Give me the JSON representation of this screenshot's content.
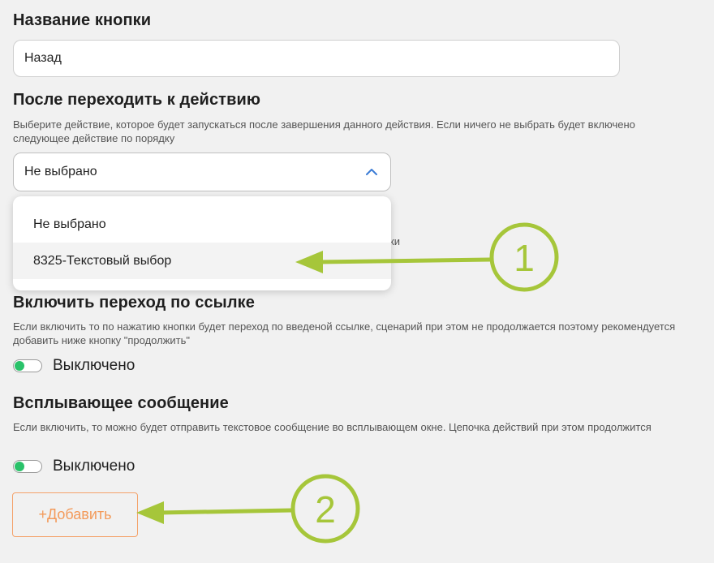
{
  "button_name": {
    "title": "Название кнопки",
    "value": "Назад"
  },
  "next_action": {
    "title": "После переходить к действию",
    "description": "Выберите действие, которое будет запускаться после завершения данного действия. Если ничего не выбрать будет включено следующее действие по порядку",
    "selected": "Не выбрано",
    "options": [
      "Не выбрано",
      "8325-Текстовый выбор"
    ],
    "hidden_text_fragment": "ки"
  },
  "link_transition": {
    "title": "Включить переход по ссылке",
    "description": "Если включить то по нажатию кнопки будет переход по введеной ссылке, сценарий при этом не продолжается поэтому рекомендуется добавить ниже кнопку \"продолжить\"",
    "toggle_label": "Выключено"
  },
  "popup_message": {
    "title": "Всплывающее сообщение",
    "description": "Если включить, то можно будет отправить текстовое сообщение во всплывающем окне. Цепочка действий при этом продолжится",
    "toggle_label": "Выключено"
  },
  "add_button": {
    "label": "+Добавить"
  },
  "annotations": [
    {
      "label": "1"
    },
    {
      "label": "2"
    }
  ],
  "colors": {
    "accent_green": "#a6c63a",
    "toggle_knob": "#2ac26a",
    "add_button_orange": "#f39a5a",
    "chevron_blue": "#3a7bd5"
  },
  "icons": {
    "select_chevron": "chevron-up-icon"
  }
}
